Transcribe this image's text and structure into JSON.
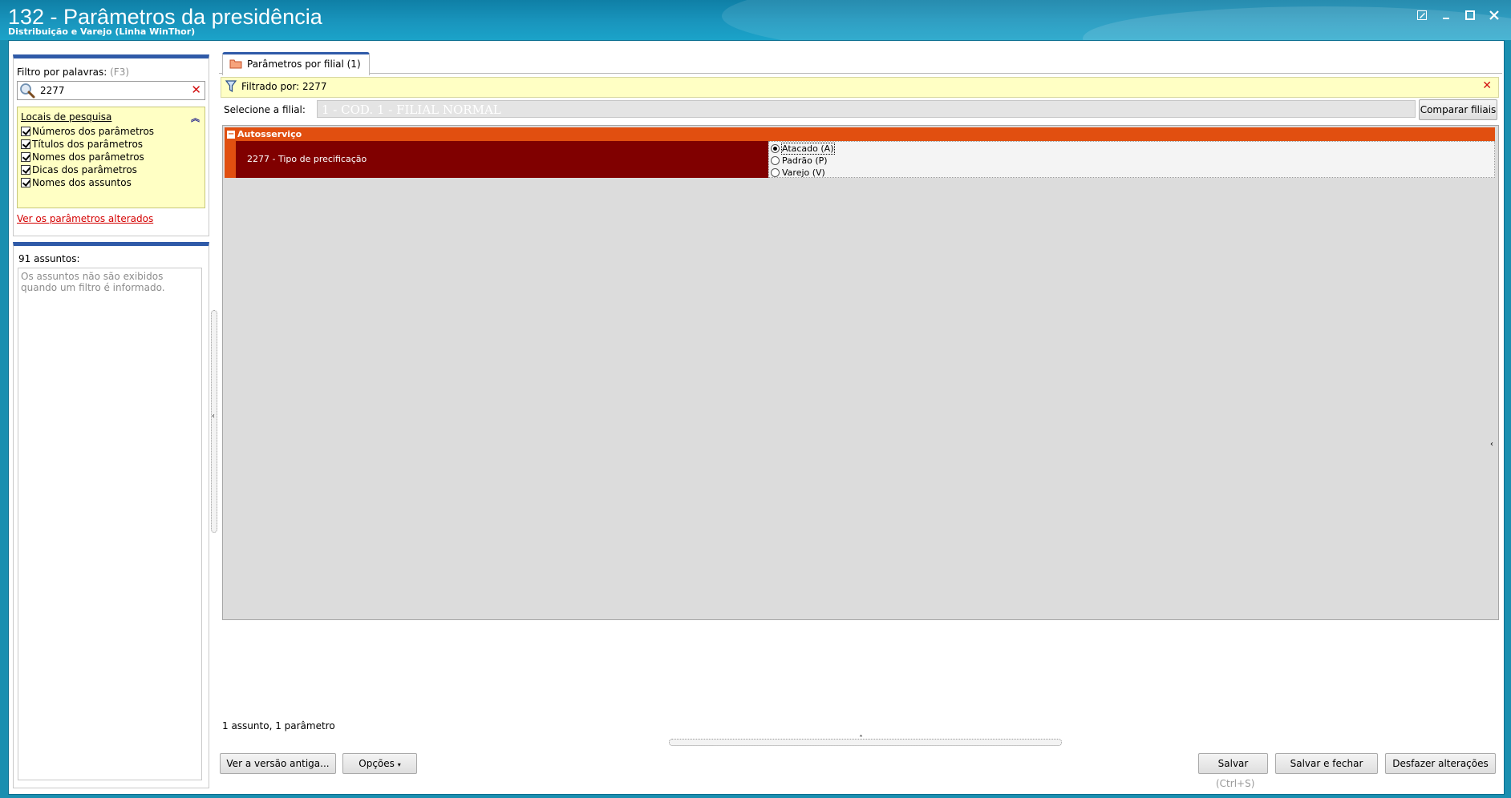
{
  "window": {
    "title": "132 - Parâmetros da presidência",
    "subtitle": "Distribuição e Varejo (Linha WinThor)"
  },
  "left_panel": {
    "filter_label": "Filtro por palavras:",
    "filter_hint": "(F3)",
    "search_value": "2277",
    "locations_title": "Locais de pesquisa",
    "locations": [
      {
        "label": "Números dos parâmetros",
        "checked": true
      },
      {
        "label": "Títulos dos parâmetros",
        "checked": true
      },
      {
        "label": "Nomes dos parâmetros",
        "checked": true
      },
      {
        "label": "Dicas dos parâmetros",
        "checked": true
      },
      {
        "label": "Nomes dos assuntos",
        "checked": true
      }
    ],
    "altered_link": "Ver os parâmetros alterados",
    "subjects_count": "91 assuntos:",
    "subjects_empty": "Os assuntos não são exibidos quando um filtro é informado."
  },
  "tabs": [
    {
      "label": "Parâmetros por filial  (1)",
      "active": true
    }
  ],
  "filter_bar": {
    "text": "Filtrado por: 2277"
  },
  "branch": {
    "label": "Selecione a filial:",
    "value": "1 - COD. 1 - FILIAL NORMAL",
    "compare_button": "Comparar filiais"
  },
  "grid": {
    "group": "Autosserviço",
    "parameter": {
      "name": "2277 - Tipo de precificação",
      "options": [
        {
          "label": "Atacado (A)",
          "selected": true
        },
        {
          "label": "Padrão (P)",
          "selected": false
        },
        {
          "label": "Varejo (V)",
          "selected": false
        }
      ]
    }
  },
  "status": "1 assunto, 1 parâmetro",
  "footer": {
    "old_version_button": "Ver a versão antiga...",
    "options_button": "Opções",
    "save_button": "Salvar",
    "save_shortcut": "(Ctrl+S)",
    "save_close_button": "Salvar e fechar",
    "undo_button": "Desfazer alterações"
  },
  "colors": {
    "title_bar": "#1995bd",
    "group_header": "#e14f10",
    "param_name_bg": "#800000",
    "filter_bg": "#ffffc4"
  }
}
